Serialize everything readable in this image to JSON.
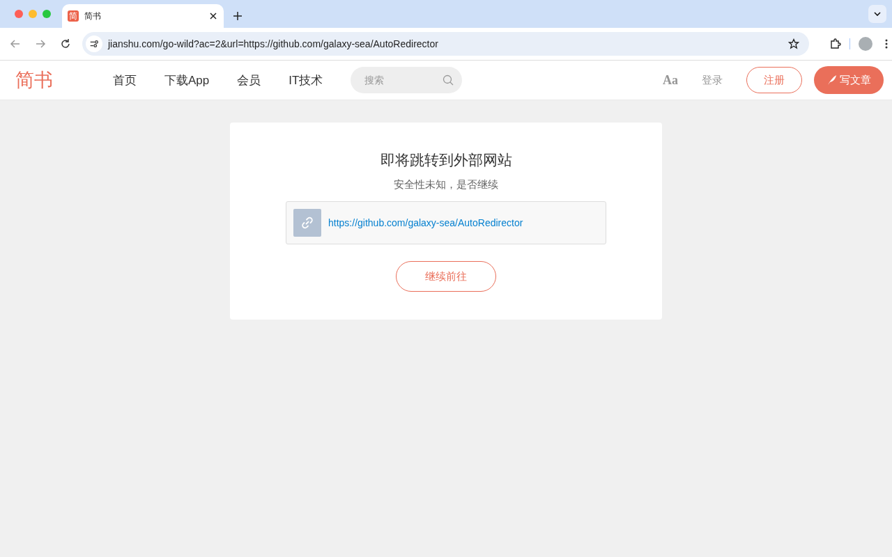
{
  "browser": {
    "tab": {
      "favicon_text": "简",
      "title": "简书"
    },
    "url": "jianshu.com/go-wild?ac=2&url=https://github.com/galaxy-sea/AutoRedirector"
  },
  "site_header": {
    "logo": "简书",
    "nav_items": [
      {
        "label": "首页"
      },
      {
        "label": "下载App"
      },
      {
        "label": "会员"
      },
      {
        "label": "IT技术"
      }
    ],
    "search": {
      "placeholder": "搜索"
    },
    "font_toggle": "Aa",
    "login": "登录",
    "register": "注册",
    "write": "写文章"
  },
  "card": {
    "title": "即将跳转到外部网站",
    "subtitle": "安全性未知，是否继续",
    "link": "https://github.com/galaxy-sea/AutoRedirector",
    "button": "继续前往"
  }
}
